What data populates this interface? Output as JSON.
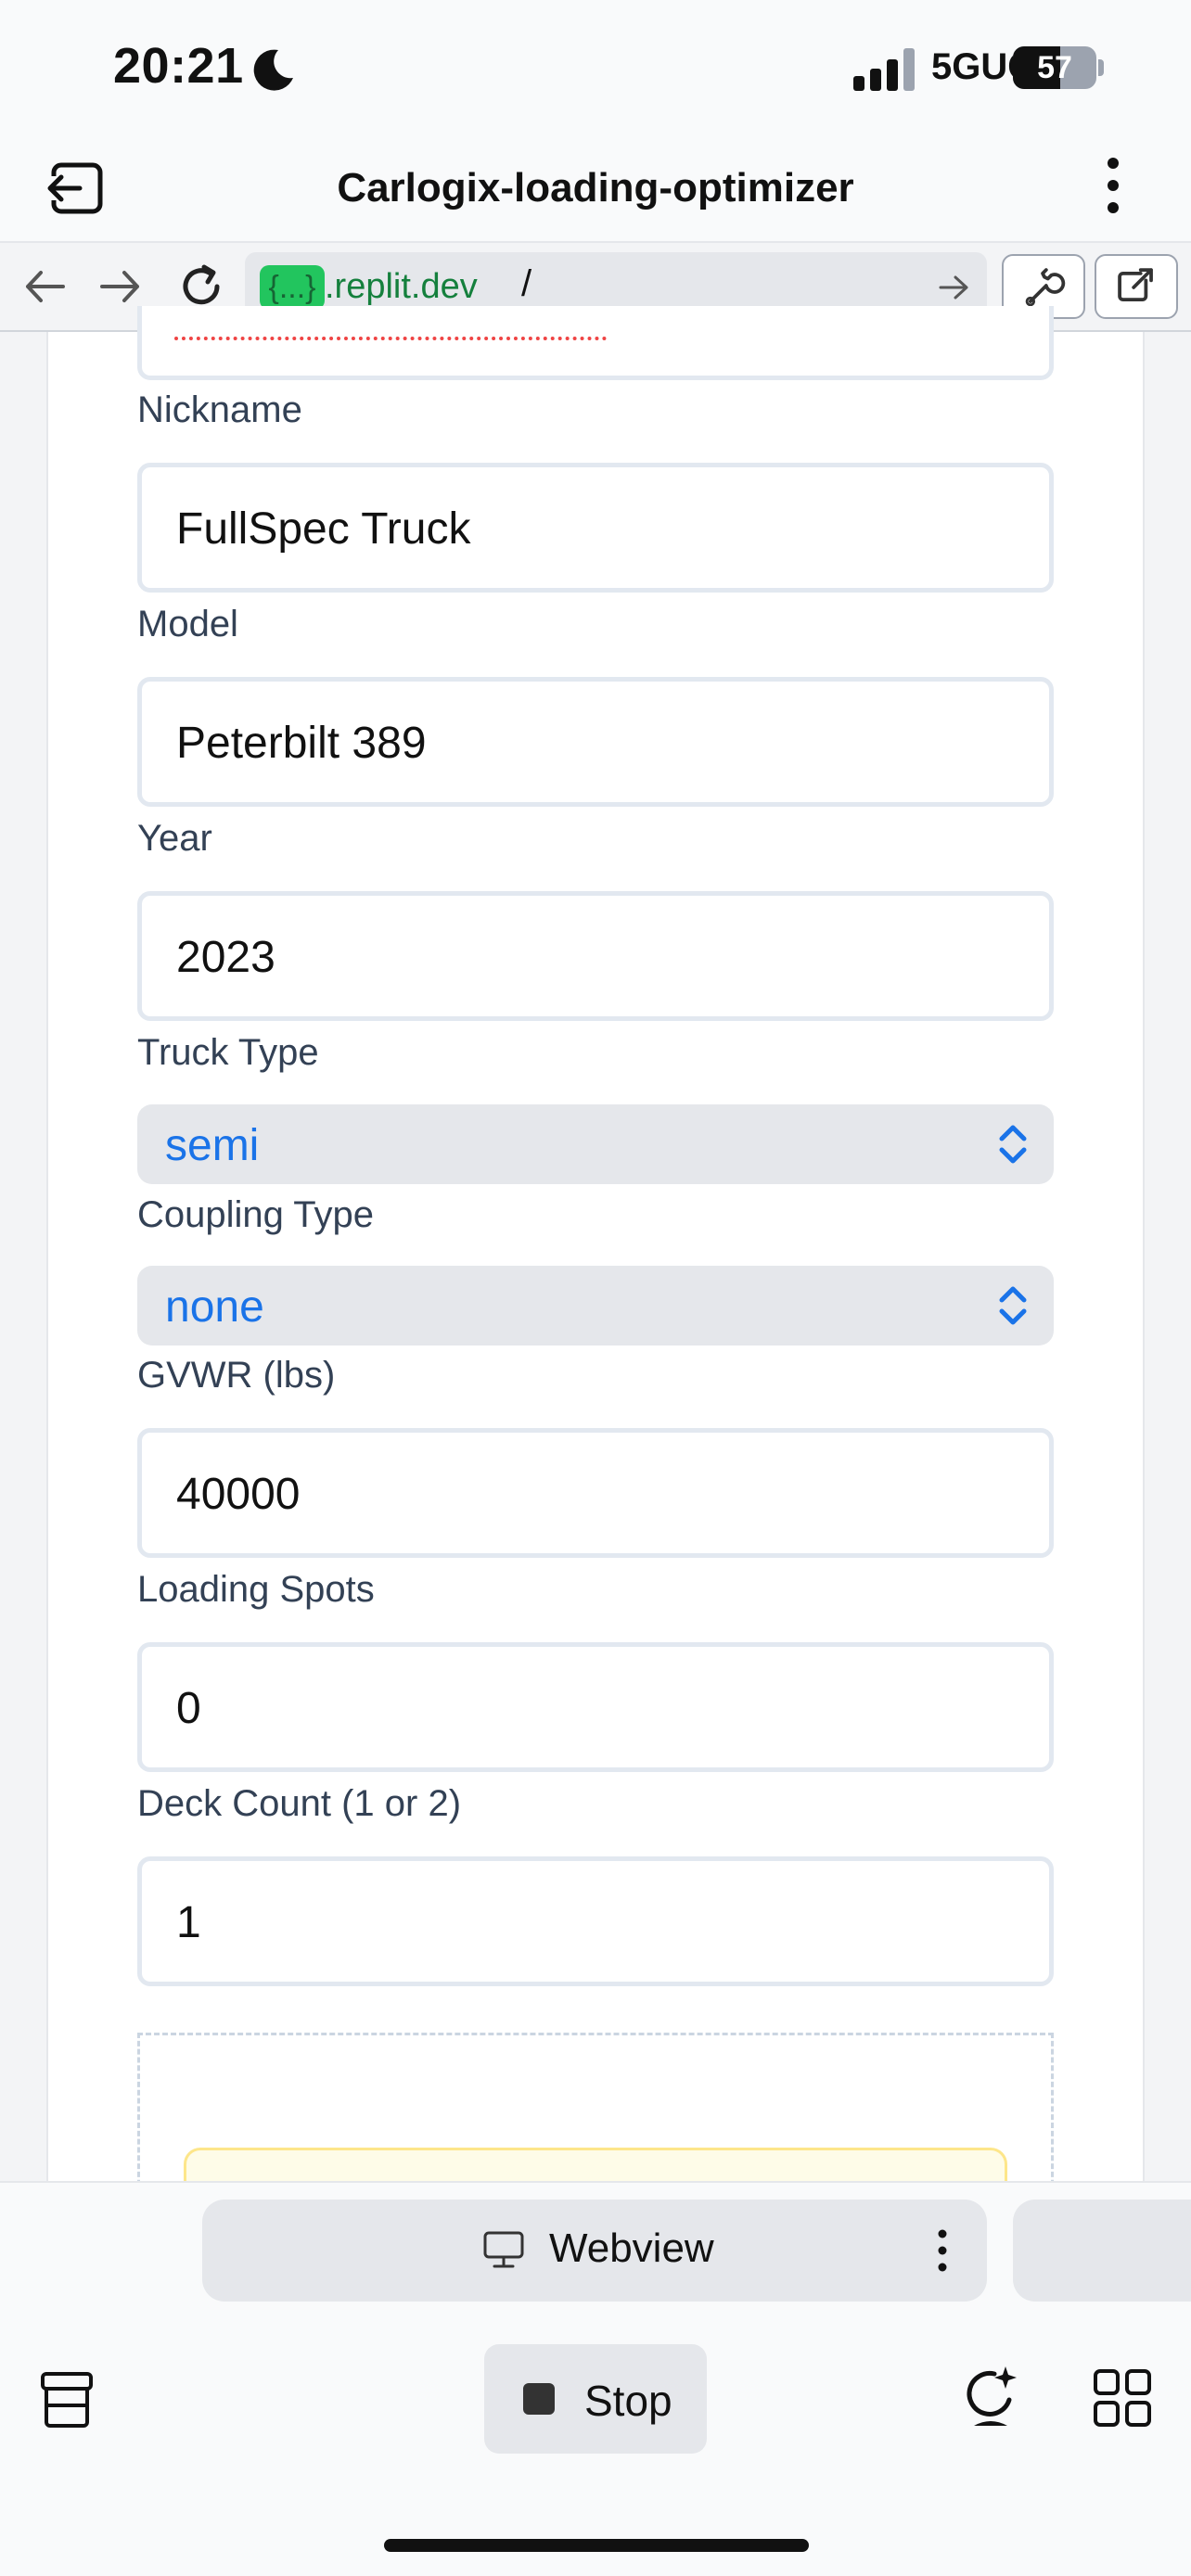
{
  "status_bar": {
    "time": "20:21",
    "network": "5GUC",
    "battery_level": "57",
    "battery_fraction": 0.57
  },
  "header": {
    "title": "Carlogix-loading-optimizer"
  },
  "browser": {
    "url_chip": "{...}",
    "url_domain": ".replit.dev",
    "url_path": "/"
  },
  "form": {
    "nickname": {
      "label": "Nickname",
      "value": "FullSpec Truck"
    },
    "model": {
      "label": "Model",
      "value": "Peterbilt 389"
    },
    "year": {
      "label": "Year",
      "value": "2023"
    },
    "truck_type": {
      "label": "Truck Type",
      "value": "semi"
    },
    "coupling_type": {
      "label": "Coupling Type",
      "value": "none"
    },
    "gvwr": {
      "label": "GVWR (lbs)",
      "value": "40000"
    },
    "loading_spots": {
      "label": "Loading Spots",
      "value": "0"
    },
    "deck_count": {
      "label": "Deck Count (1 or 2)",
      "value": "1"
    }
  },
  "bottom": {
    "webview_label": "Webview",
    "stop_label": "Stop"
  },
  "colors": {
    "select_text": "#1a73e8",
    "url_green": "#22c55e",
    "label": "#334155"
  },
  "icons": [
    "moon-icon",
    "signal-icon",
    "exit-icon",
    "kebab-icon",
    "back-icon",
    "forward-icon",
    "reload-icon",
    "arrow-right-icon",
    "wrench-icon",
    "external-link-icon",
    "chevron-updown-icon",
    "monitor-icon",
    "more-vertical-icon",
    "stack-icon",
    "stop-icon",
    "assistant-icon",
    "grid-icon"
  ]
}
